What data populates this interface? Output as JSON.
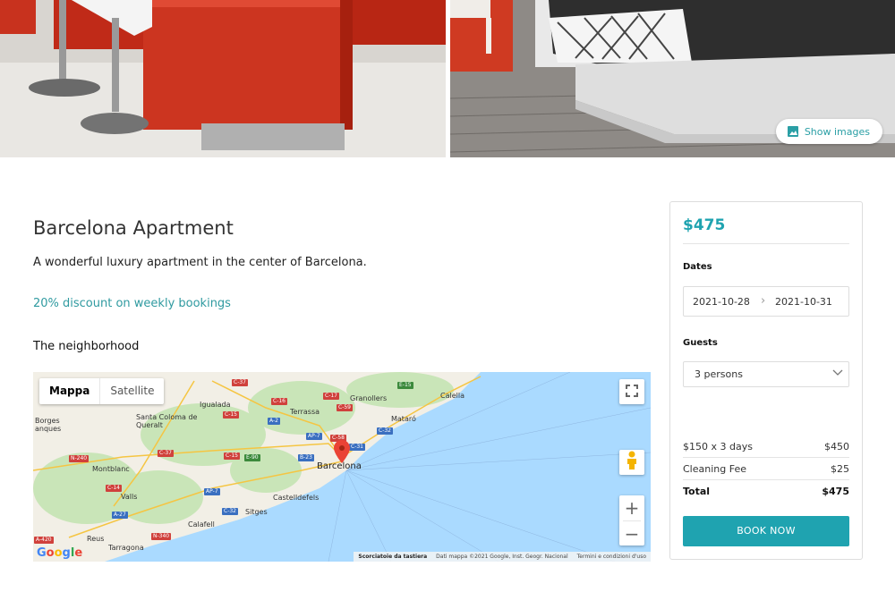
{
  "gallery": {
    "show_images_label": "Show images"
  },
  "listing": {
    "title": "Barcelona Apartment",
    "description": "A wonderful luxury apartment in the center of Barcelona.",
    "discount": "20% discount on weekly bookings",
    "neighborhood_heading": "The neighborhood"
  },
  "map": {
    "type_buttons": [
      "Mappa",
      "Satellite"
    ],
    "cities": [
      {
        "name": "Barcelona",
        "big": true
      },
      {
        "name": "Granollers"
      },
      {
        "name": "Calella"
      },
      {
        "name": "Igualada"
      },
      {
        "name": "Terrassa"
      },
      {
        "name": "Mataró"
      },
      {
        "name": "Santa Coloma de Queralt"
      },
      {
        "name": "Borges"
      },
      {
        "name": "anques"
      },
      {
        "name": "Montblanc"
      },
      {
        "name": "Valls"
      },
      {
        "name": "Castelldefels"
      },
      {
        "name": "Sitges"
      },
      {
        "name": "Calafell"
      },
      {
        "name": "Reus"
      },
      {
        "name": "Tarragona"
      }
    ],
    "roads": [
      "C-37",
      "C-16",
      "E-15",
      "C-17",
      "C-15",
      "A-2",
      "C-59",
      "C-32",
      "AP-7",
      "C-58",
      "C-31",
      "C-37",
      "C-15",
      "E-90",
      "B-23",
      "N-240",
      "C-14",
      "AP-7",
      "C-32",
      "A-27",
      "N-340",
      "A-420"
    ],
    "attribution": {
      "shortcuts": "Scorciatoie da tastiera",
      "data": "Dati mappa ©2021 Google, Inst. Geogr. Nacional",
      "terms": "Termini e condizioni d'uso"
    },
    "google": [
      "G",
      "o",
      "o",
      "g",
      "l",
      "e"
    ]
  },
  "booking": {
    "price": "$475",
    "dates_label": "Dates",
    "date_from": "2021-10-28",
    "date_to": "2021-10-31",
    "guests_label": "Guests",
    "guests_value": "3 persons",
    "lines": [
      {
        "label": "$150 x 3 days",
        "amount": "$450"
      },
      {
        "label": "Cleaning Fee",
        "amount": "$25"
      },
      {
        "label": "Total",
        "amount": "$475"
      }
    ],
    "book_label": "BOOK NOW"
  },
  "colors": {
    "accent": "#1fa3b0",
    "discount_text": "#2f9aa0",
    "kitchen_red": "#c8321e",
    "map_water": "#aadaff"
  }
}
